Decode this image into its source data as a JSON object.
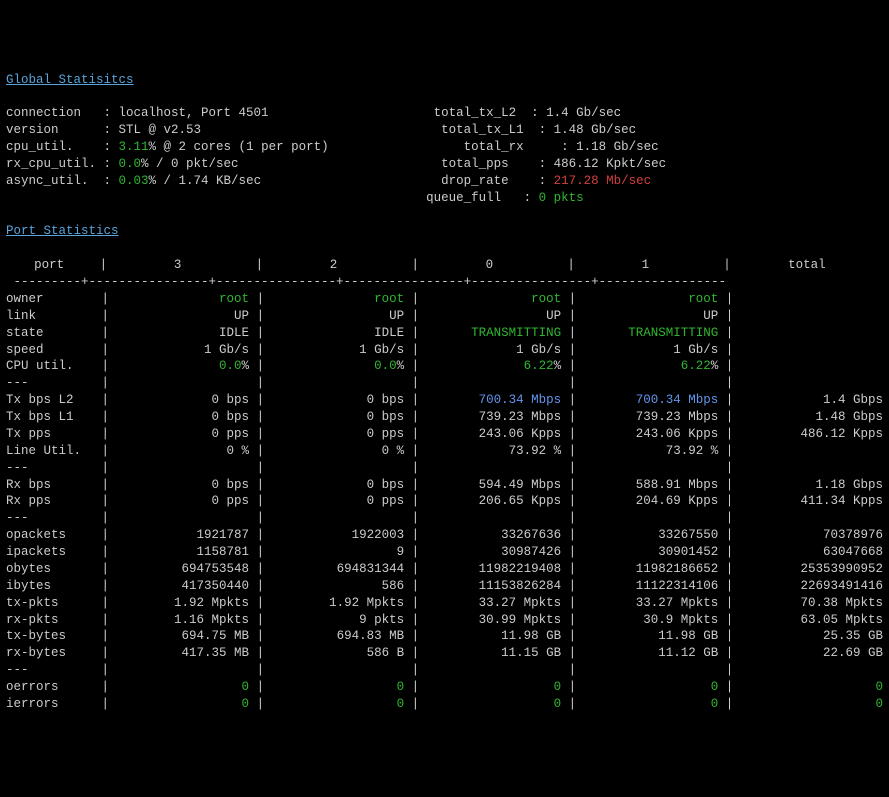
{
  "global_title": "Global Statisitcs",
  "port_title": "Port Statistics",
  "global_left": {
    "connection": {
      "label": "connection",
      "value": "localhost, Port 4501"
    },
    "version": {
      "label": "version",
      "value": "STL @ v2.53"
    },
    "cpu_util": {
      "label": "cpu_util.",
      "value_pct": "3.11",
      "suffix": "% @ 2 cores (1 per port)"
    },
    "rx_cpu_util": {
      "label": "rx_cpu_util.",
      "value_pct": "0.0",
      "suffix": "% / 0 pkt/sec"
    },
    "async_util": {
      "label": "async_util.",
      "value_pct": "0.03",
      "suffix": "% / 1.74 KB/sec"
    }
  },
  "global_right": {
    "total_tx_l2": {
      "label": "total_tx_L2",
      "value": "1.4 Gb/sec"
    },
    "total_tx_l1": {
      "label": "total_tx_L1",
      "value": "1.48 Gb/sec"
    },
    "total_rx": {
      "label": "total_rx",
      "value": "1.18 Gb/sec"
    },
    "total_pps": {
      "label": "total_pps",
      "value": "486.12 Kpkt/sec"
    },
    "drop_rate": {
      "label": "drop_rate",
      "value": "217.28 Mb/sec"
    },
    "queue_full": {
      "label": "queue_full",
      "value": "0 pkts"
    }
  },
  "port_header": {
    "port": "port",
    "p3": "3",
    "p2": "2",
    "p0": "0",
    "p1": "1",
    "total": "total"
  },
  "rows": {
    "owner": {
      "label": "owner",
      "p3": "root",
      "p2": "root",
      "p0": "root",
      "p1": "root",
      "tot": ""
    },
    "link": {
      "label": "link",
      "p3": "UP",
      "p2": "UP",
      "p0": "UP",
      "p1": "UP",
      "tot": ""
    },
    "state": {
      "label": "state",
      "p3": "IDLE",
      "p2": "IDLE",
      "p0": "TRANSMITTING",
      "p1": "TRANSMITTING",
      "tot": ""
    },
    "speed": {
      "label": "speed",
      "p3": "1 Gb/s",
      "p2": "1 Gb/s",
      "p0": "1 Gb/s",
      "p1": "1 Gb/s",
      "tot": ""
    },
    "cpu": {
      "label": "CPU util.",
      "p3": "0.0",
      "p2": "0.0",
      "p0": "6.22",
      "p1": "6.22",
      "tot": "",
      "pct": "%"
    },
    "txbpsl2": {
      "label": "Tx bps L2",
      "p3": "0 bps",
      "p2": "0 bps",
      "p0": "700.34 Mbps",
      "p1": "700.34 Mbps",
      "tot": "1.4 Gbps"
    },
    "txbpsl1": {
      "label": "Tx bps L1",
      "p3": "0 bps",
      "p2": "0 bps",
      "p0": "739.23 Mbps",
      "p1": "739.23 Mbps",
      "tot": "1.48 Gbps"
    },
    "txpps": {
      "label": "Tx pps",
      "p3": "0 pps",
      "p2": "0 pps",
      "p0": "243.06 Kpps",
      "p1": "243.06 Kpps",
      "tot": "486.12 Kpps"
    },
    "lineutil": {
      "label": "Line Util.",
      "p3": "0 %",
      "p2": "0 %",
      "p0": "73.92 %",
      "p1": "73.92 %",
      "tot": ""
    },
    "rxbps": {
      "label": "Rx bps",
      "p3": "0 bps",
      "p2": "0 bps",
      "p0": "594.49 Mbps",
      "p1": "588.91 Mbps",
      "tot": "1.18 Gbps"
    },
    "rxpps": {
      "label": "Rx pps",
      "p3": "0 pps",
      "p2": "0 pps",
      "p0": "206.65 Kpps",
      "p1": "204.69 Kpps",
      "tot": "411.34 Kpps"
    },
    "opackets": {
      "label": "opackets",
      "p3": "1921787",
      "p2": "1922003",
      "p0": "33267636",
      "p1": "33267550",
      "tot": "70378976"
    },
    "ipackets": {
      "label": "ipackets",
      "p3": "1158781",
      "p2": "9",
      "p0": "30987426",
      "p1": "30901452",
      "tot": "63047668"
    },
    "obytes": {
      "label": "obytes",
      "p3": "694753548",
      "p2": "694831344",
      "p0": "11982219408",
      "p1": "11982186652",
      "tot": "25353990952"
    },
    "ibytes": {
      "label": "ibytes",
      "p3": "417350440",
      "p2": "586",
      "p0": "11153826284",
      "p1": "11122314106",
      "tot": "22693491416"
    },
    "txpkts": {
      "label": "tx-pkts",
      "p3": "1.92 Mpkts",
      "p2": "1.92 Mpkts",
      "p0": "33.27 Mpkts",
      "p1": "33.27 Mpkts",
      "tot": "70.38 Mpkts"
    },
    "rxpkts": {
      "label": "rx-pkts",
      "p3": "1.16 Mpkts",
      "p2": "9 pkts",
      "p0": "30.99 Mpkts",
      "p1": "30.9 Mpkts",
      "tot": "63.05 Mpkts"
    },
    "txbytes": {
      "label": "tx-bytes",
      "p3": "694.75 MB",
      "p2": "694.83 MB",
      "p0": "11.98 GB",
      "p1": "11.98 GB",
      "tot": "25.35 GB"
    },
    "rxbytes": {
      "label": "rx-bytes",
      "p3": "417.35 MB",
      "p2": "586 B",
      "p0": "11.15 GB",
      "p1": "11.12 GB",
      "tot": "22.69 GB"
    },
    "oerrors": {
      "label": "oerrors",
      "p3": "0",
      "p2": "0",
      "p0": "0",
      "p1": "0",
      "tot": "0"
    },
    "ierrors": {
      "label": "ierrors",
      "p3": "0",
      "p2": "0",
      "p0": "0",
      "p1": "0",
      "tot": "0"
    }
  },
  "sep": "---",
  "dashline": " ---------+----------------+----------------+----------------+----------------+-----------------"
}
